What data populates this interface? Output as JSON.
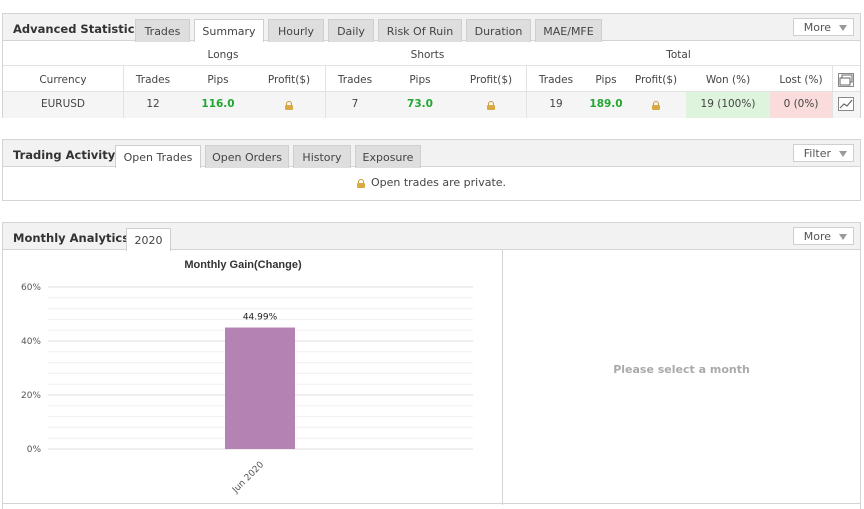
{
  "advanced": {
    "title": "Advanced Statistics",
    "tabs": [
      "Trades",
      "Summary",
      "Hourly",
      "Daily",
      "Risk Of Ruin",
      "Duration",
      "MAE/MFE"
    ],
    "active_tab": "Summary",
    "more_label": "More",
    "groups": {
      "longs": "Longs",
      "shorts": "Shorts",
      "total": "Total"
    },
    "columns": [
      "Currency",
      "Trades",
      "Pips",
      "Profit($)",
      "Trades",
      "Pips",
      "Profit($)",
      "Trades",
      "Pips",
      "Profit($)",
      "Won (%)",
      "Lost (%)"
    ],
    "row": {
      "currency": "EURUSD",
      "long_trades": "12",
      "long_pips": "116.0",
      "short_trades": "7",
      "short_pips": "73.0",
      "total_trades": "19",
      "total_pips": "189.0",
      "won": "19 (100%)",
      "lost": "0 (0%)"
    }
  },
  "trading": {
    "title": "Trading Activity",
    "tabs": [
      "Open Trades",
      "Open Orders",
      "History",
      "Exposure"
    ],
    "active_tab": "Open Trades",
    "filter_label": "Filter",
    "private_msg": "Open trades are private."
  },
  "monthly": {
    "title": "Monthly Analytics",
    "tabs": [
      "2020"
    ],
    "more_label": "More",
    "select_msg": "Please select a month"
  },
  "chart_data": {
    "type": "bar",
    "title": "Monthly Gain(Change)",
    "categories": [
      "Jun 2020"
    ],
    "values": [
      44.99
    ],
    "value_labels": [
      "44.99%"
    ],
    "yticks": [
      "0%",
      "20%",
      "40%",
      "60%"
    ],
    "ylim": [
      0,
      60
    ],
    "bar_color": "#b483b4",
    "grid": true
  },
  "colors": {
    "green_text": "#22a632",
    "won_bg": "#dff4dc",
    "lost_bg": "#fbdcdc",
    "header_bg": "#f2f2f2"
  }
}
